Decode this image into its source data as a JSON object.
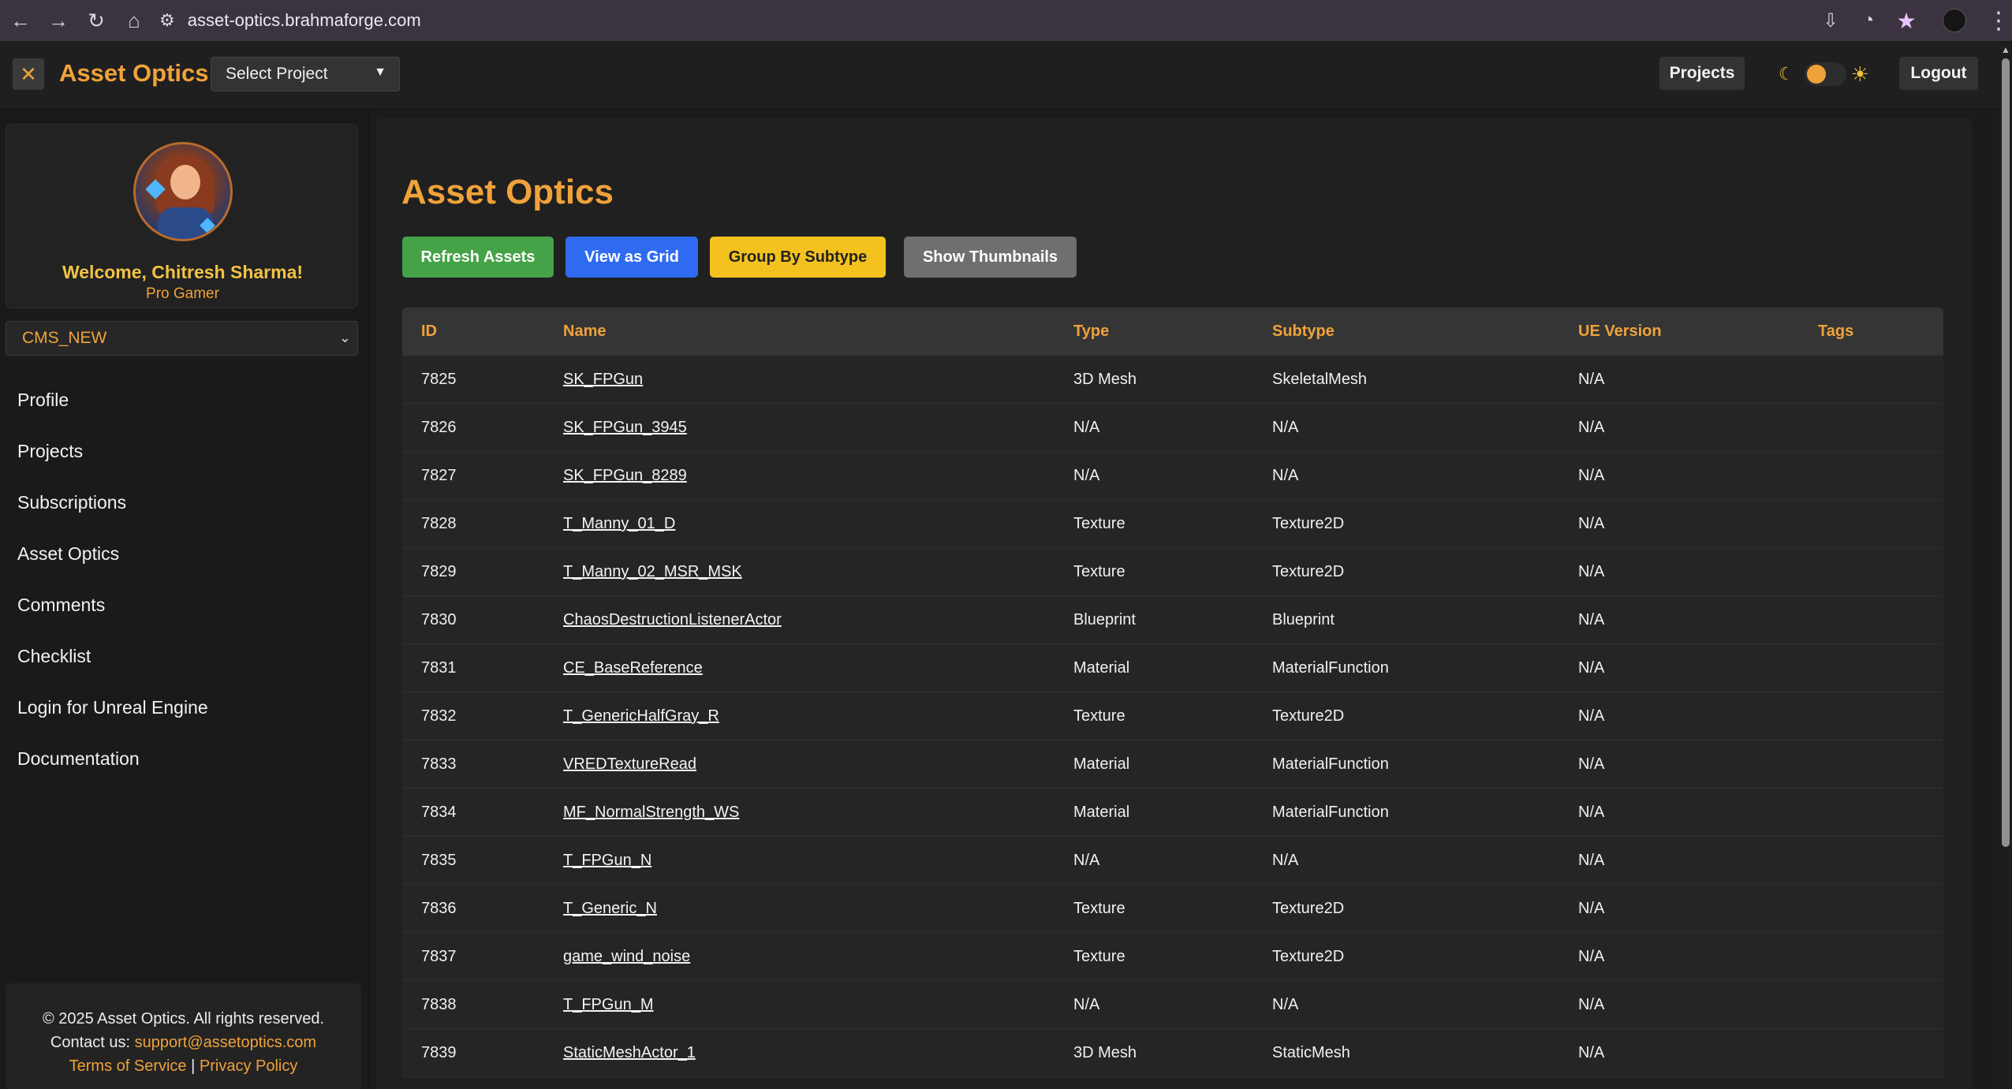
{
  "browser": {
    "url": "asset-optics.brahmaforge.com",
    "back_icon": "←",
    "forward_icon": "→",
    "reload_icon": "↻",
    "home_icon": "⌂",
    "site_info_icon": "⚙",
    "install_icon": "⇩",
    "performance_icon": "◔",
    "star_icon": "★",
    "menu_icon": "⋮"
  },
  "header": {
    "close_icon": "✕",
    "brand": "Asset Optics",
    "project_select": "Select Project",
    "caret_icon": "▼",
    "projects_button": "Projects",
    "moon_icon": "☾",
    "sun_icon": "☀",
    "logout_button": "Logout"
  },
  "sidebar": {
    "welcome": "Welcome, Chitresh Sharma!",
    "role": "Pro Gamer",
    "workspace_select": "CMS_NEW",
    "chevron_icon": "⌄",
    "items": [
      {
        "label": "Profile"
      },
      {
        "label": "Projects"
      },
      {
        "label": "Subscriptions"
      },
      {
        "label": "Asset Optics"
      },
      {
        "label": "Comments"
      },
      {
        "label": "Checklist"
      },
      {
        "label": "Login for Unreal Engine"
      },
      {
        "label": "Documentation"
      }
    ],
    "footer": {
      "copyright": "© 2025 Asset Optics. All rights reserved.",
      "contact_label": "Contact us:",
      "contact_email": "support@assetoptics.com",
      "terms": "Terms of Service",
      "separator": "|",
      "privacy": "Privacy Policy"
    }
  },
  "main": {
    "title": "Asset Optics",
    "buttons": {
      "refresh": "Refresh Assets",
      "grid": "View as Grid",
      "group": "Group By Subtype",
      "thumbnails": "Show Thumbnails"
    },
    "columns": [
      "ID",
      "Name",
      "Type",
      "Subtype",
      "UE Version",
      "Tags"
    ],
    "rows": [
      {
        "id": "7825",
        "name": "SK_FPGun",
        "type": "3D Mesh",
        "subtype": "SkeletalMesh",
        "ue": "N/A",
        "tags": ""
      },
      {
        "id": "7826",
        "name": "SK_FPGun_3945",
        "type": "N/A",
        "subtype": "N/A",
        "ue": "N/A",
        "tags": ""
      },
      {
        "id": "7827",
        "name": "SK_FPGun_8289",
        "type": "N/A",
        "subtype": "N/A",
        "ue": "N/A",
        "tags": ""
      },
      {
        "id": "7828",
        "name": "T_Manny_01_D",
        "type": "Texture",
        "subtype": "Texture2D",
        "ue": "N/A",
        "tags": ""
      },
      {
        "id": "7829",
        "name": "T_Manny_02_MSR_MSK",
        "type": "Texture",
        "subtype": "Texture2D",
        "ue": "N/A",
        "tags": ""
      },
      {
        "id": "7830",
        "name": "ChaosDestructionListenerActor",
        "type": "Blueprint",
        "subtype": "Blueprint",
        "ue": "N/A",
        "tags": ""
      },
      {
        "id": "7831",
        "name": "CE_BaseReference",
        "type": "Material",
        "subtype": "MaterialFunction",
        "ue": "N/A",
        "tags": ""
      },
      {
        "id": "7832",
        "name": "T_GenericHalfGray_R",
        "type": "Texture",
        "subtype": "Texture2D",
        "ue": "N/A",
        "tags": ""
      },
      {
        "id": "7833",
        "name": "VREDTextureRead",
        "type": "Material",
        "subtype": "MaterialFunction",
        "ue": "N/A",
        "tags": ""
      },
      {
        "id": "7834",
        "name": "MF_NormalStrength_WS",
        "type": "Material",
        "subtype": "MaterialFunction",
        "ue": "N/A",
        "tags": ""
      },
      {
        "id": "7835",
        "name": "T_FPGun_N",
        "type": "N/A",
        "subtype": "N/A",
        "ue": "N/A",
        "tags": ""
      },
      {
        "id": "7836",
        "name": "T_Generic_N",
        "type": "Texture",
        "subtype": "Texture2D",
        "ue": "N/A",
        "tags": ""
      },
      {
        "id": "7837",
        "name": "game_wind_noise",
        "type": "Texture",
        "subtype": "Texture2D",
        "ue": "N/A",
        "tags": ""
      },
      {
        "id": "7838",
        "name": "T_FPGun_M",
        "type": "N/A",
        "subtype": "N/A",
        "ue": "N/A",
        "tags": ""
      },
      {
        "id": "7839",
        "name": "StaticMeshActor_1",
        "type": "3D Mesh",
        "subtype": "StaticMesh",
        "ue": "N/A",
        "tags": ""
      }
    ]
  },
  "colors": {
    "accent": "#f0a23a",
    "refresh": "#44a347",
    "grid": "#2f6bf0",
    "group": "#f4c21e",
    "thumbnails": "#6f6f6f"
  }
}
